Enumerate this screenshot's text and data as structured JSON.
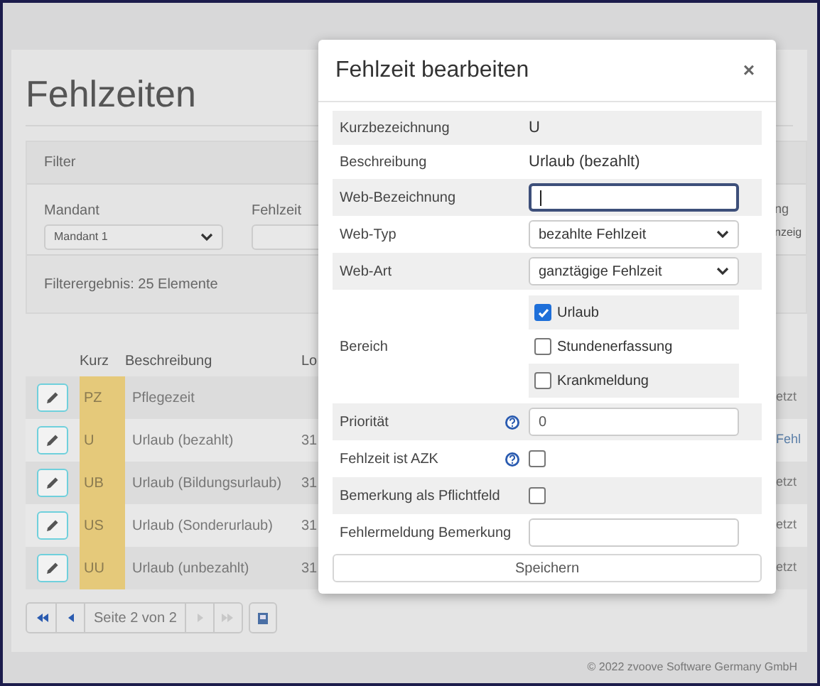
{
  "page": {
    "title": "Fehlzeiten"
  },
  "filter": {
    "title": "Filter",
    "fields": [
      {
        "kind": "select",
        "label": "Mandant",
        "value": "Mandant 1"
      },
      {
        "kind": "input",
        "label": "Fehlzeit"
      },
      {
        "kind": "partial",
        "label": "ng",
        "value": "nzeig"
      }
    ],
    "result": "Filterergebnis: 25 Elemente"
  },
  "table": {
    "columns": [
      "Kurz",
      "Beschreibung",
      "Lo"
    ],
    "rows": [
      {
        "code": "PZ",
        "description": "Pflegezeit",
        "column_last": "etzt"
      },
      {
        "code": "U",
        "description": "Urlaub (bezahlt)",
        "column_3": "31",
        "column_last": "Fehl"
      },
      {
        "code": "UB",
        "description": "Urlaub (Bildungsurlaub)",
        "column_3": "31",
        "column_last": "etzt"
      },
      {
        "code": "US",
        "description": "Urlaub (Sonderurlaub)",
        "column_3": "31",
        "column_last": "etzt"
      },
      {
        "code": "UU",
        "description": "Urlaub (unbezahlt)",
        "column_3": "31",
        "column_last": "etzt"
      }
    ]
  },
  "pagination": {
    "label": "Seite 2 von 2",
    "buttons": [
      {
        "kind": "first",
        "disabled": false
      },
      {
        "kind": "prev",
        "disabled": false
      },
      {
        "kind": "label"
      },
      {
        "kind": "next",
        "disabled": true
      },
      {
        "kind": "last",
        "disabled": true
      }
    ]
  },
  "footer": "© 2022 zvoove Software Germany GmbH",
  "modal": {
    "title": "Fehlzeit bearbeiten",
    "close": "×",
    "rows": [
      {
        "kind": "text",
        "label": "Kurzbezeichnung",
        "value": "U",
        "help": false
      },
      {
        "kind": "text",
        "label": "Beschreibung",
        "value": "Urlaub (bezahlt)",
        "help": false
      },
      {
        "kind": "input",
        "label": "Web-Bezeichnung",
        "focused": true,
        "help": false
      },
      {
        "kind": "select",
        "label": "Web-Typ",
        "value": "bezahlte Fehlzeit",
        "help": false
      },
      {
        "kind": "select",
        "label": "Web-Art",
        "value": "ganztägige Fehlzeit",
        "help": false
      },
      {
        "kind": "checks",
        "label": "Bereich",
        "help": false,
        "options": [
          {
            "label": "Urlaub",
            "checked": true
          },
          {
            "label": "Stundenerfassung",
            "checked": false
          },
          {
            "label": "Krankmeldung",
            "checked": false
          }
        ]
      },
      {
        "kind": "input",
        "label": "Priorität",
        "value": "0",
        "focused": false,
        "help": true
      },
      {
        "kind": "checkbox",
        "label": "Fehlzeit ist AZK",
        "checked": false,
        "help": true
      },
      {
        "kind": "checkbox",
        "label": "Bemerkung als Pflichtfeld",
        "checked": false,
        "help": false
      },
      {
        "kind": "input",
        "label": "Fehlermeldung Bemerkung",
        "focused": false,
        "help": false
      }
    ],
    "button": "Speichern"
  }
}
